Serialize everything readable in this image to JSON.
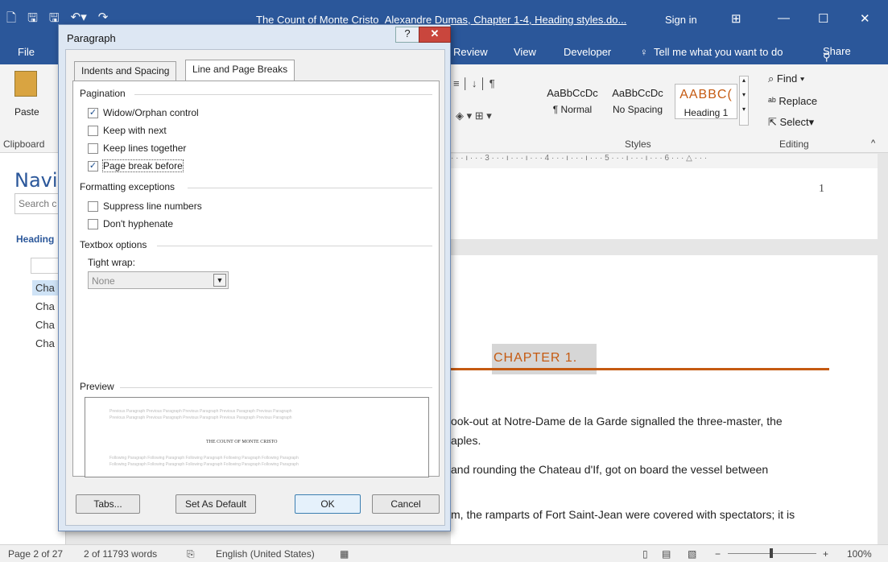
{
  "titlebar": {
    "title": "The Count of Monte Cristo_Alexandre Dumas, Chapter 1-4, Heading styles.do...",
    "sign_in": "Sign in"
  },
  "tabs": {
    "file": "File",
    "review": "Review",
    "view": "View",
    "developer": "Developer",
    "tell_me": "Tell me what you want to do",
    "share": "Share"
  },
  "ribbon": {
    "paste": "Paste",
    "clipboard": "Clipboard",
    "styles_label": "Styles",
    "editing_label": "Editing",
    "styles": [
      {
        "sample": "AaBbCcDc",
        "name": "¶ Normal"
      },
      {
        "sample": "AaBbCcDc",
        "name": "No Spacing"
      },
      {
        "sample": "AABBC(",
        "name": "Heading 1"
      }
    ],
    "find": "Find",
    "replace": "Replace",
    "select": "Select"
  },
  "nav": {
    "title": "Navi",
    "search_placeholder": "Search c",
    "headings_tab": "Heading",
    "items": [
      "Cha",
      "Cha",
      "Cha",
      "Cha"
    ]
  },
  "document": {
    "page_number": "1",
    "chapter_heading": "CHAPTER 1.",
    "lines": [
      "ook-out at Notre-Dame de la Garde signalled the three-master, the",
      "aples.",
      "and rounding the Chateau d'If, got on board the vessel between",
      "m, the ramparts of Fort Saint-Jean were covered with spectators; it is"
    ]
  },
  "dialog": {
    "title": "Paragraph",
    "tab_indents": "Indents and Spacing",
    "tab_breaks": "Line and Page Breaks",
    "pagination": "Pagination",
    "widow_orphan": "Widow/Orphan control",
    "keep_with_next": "Keep with next",
    "keep_lines": "Keep lines together",
    "page_break": "Page break before",
    "formatting_exceptions": "Formatting exceptions",
    "suppress_line_numbers": "Suppress line numbers",
    "dont_hyphenate": "Don't hyphenate",
    "textbox_options": "Textbox options",
    "tight_wrap": "Tight wrap:",
    "tight_wrap_value": "None",
    "preview_label": "Preview",
    "preview_prev": "Previous Paragraph Previous Paragraph Previous Paragraph Previous Paragraph Previous Paragraph",
    "preview_text": "THE COUNT OF MONTE CRISTO",
    "preview_follow": "Following Paragraph Following Paragraph Following Paragraph Following Paragraph Following Paragraph",
    "tabs_button": "Tabs...",
    "set_default": "Set As Default",
    "ok": "OK",
    "cancel": "Cancel"
  },
  "statusbar": {
    "page": "Page 2 of 27",
    "words": "2 of 11793 words",
    "language": "English (United States)",
    "zoom": "100%"
  }
}
